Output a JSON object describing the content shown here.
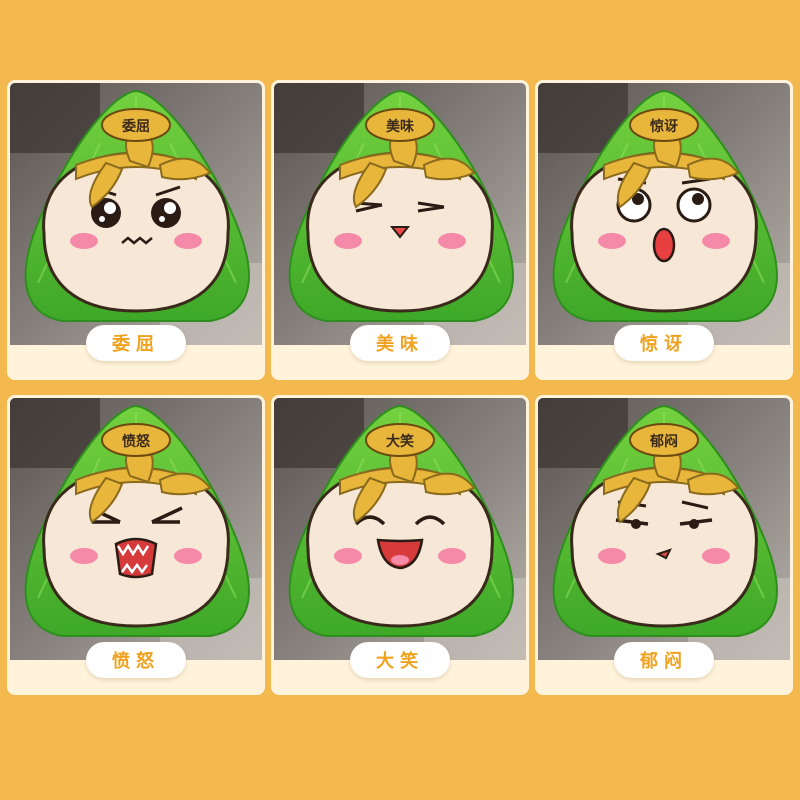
{
  "panels": [
    {
      "label": "委屈",
      "badge": "委屈",
      "expression": "aggrieved-face"
    },
    {
      "label": "美味",
      "badge": "美味",
      "expression": "delicious-face"
    },
    {
      "label": "惊讶",
      "badge": "惊讶",
      "expression": "surprised-face"
    },
    {
      "label": "愤怒",
      "badge": "愤怒",
      "expression": "angry-face"
    },
    {
      "label": "大笑",
      "badge": "大笑",
      "expression": "laughing-face"
    },
    {
      "label": "郁闷",
      "badge": "郁闷",
      "expression": "depressed-face"
    }
  ],
  "colors": {
    "background": "#f3b84e",
    "leaf": "#4fbf2e",
    "ribbon": "#e8b63a",
    "caption_text": "#f0a21e"
  }
}
